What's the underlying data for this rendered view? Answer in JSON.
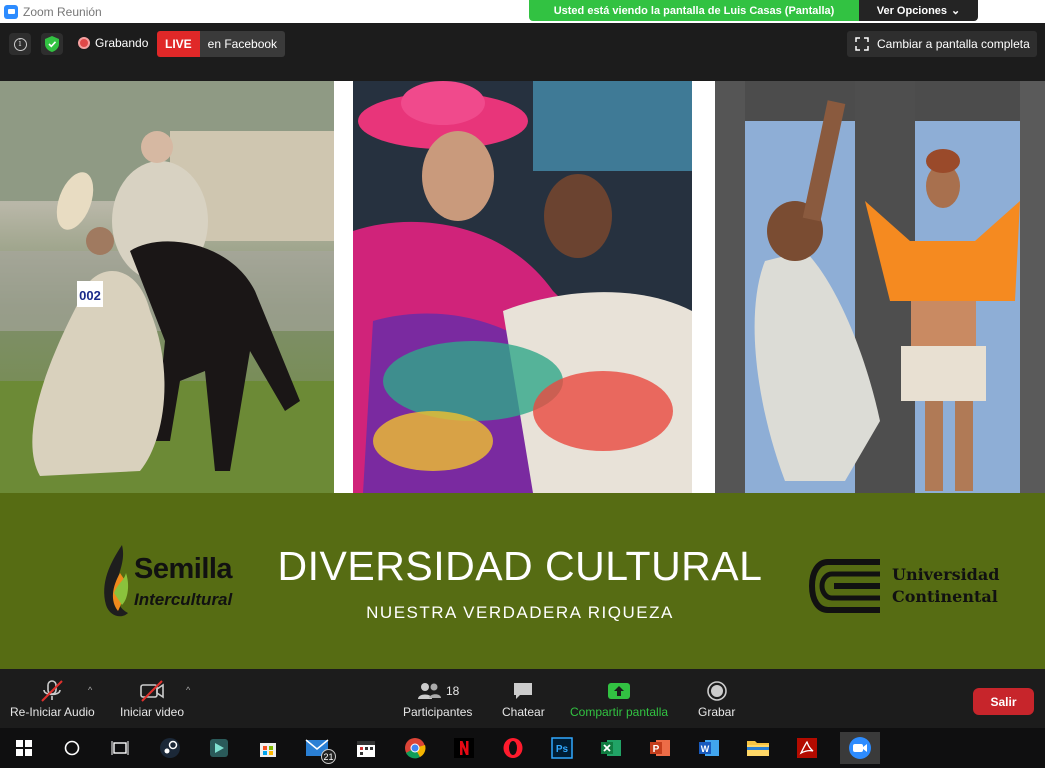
{
  "window": {
    "title": "Zoom Reunión"
  },
  "share_banner": {
    "message": "Usted está viendo la pantalla de Luis Casas (Pantalla)",
    "options_label": "Ver Opciones"
  },
  "top_bar": {
    "recording_label": "Grabando",
    "live_label": "LIVE",
    "live_platform": "en Facebook",
    "fullscreen_label": "Cambiar a pantalla completa"
  },
  "shared_slide": {
    "title": "DIVERSIDAD CULTURAL",
    "subtitle": "NUESTRA VERDADERA RIQUEZA",
    "logo_left": {
      "line1": "Semilla",
      "line2": "Intercultural"
    },
    "logo_right": {
      "line1": "Universidad",
      "line2": "Continental"
    },
    "bib_number": "002",
    "banner_color": "#566c13"
  },
  "controls": {
    "audio_label": "Re-Iniciar Audio",
    "video_label": "Iniciar video",
    "participants_label": "Participantes",
    "participants_count": "18",
    "chat_label": "Chatear",
    "share_label": "Compartir pantalla",
    "record_label": "Grabar",
    "leave_label": "Salir",
    "share_color": "#32c242",
    "leave_color": "#c7252b"
  },
  "taskbar": {
    "mail_badge": "21",
    "icons": [
      "windows-start-icon",
      "search-circle-icon",
      "task-view-icon",
      "steam-icon",
      "filmora-icon",
      "store-icon",
      "mail-icon",
      "calendar-icon",
      "chrome-icon",
      "netflix-icon",
      "opera-icon",
      "photoshop-icon",
      "excel-icon",
      "powerpoint-icon",
      "word-icon",
      "file-explorer-icon",
      "acrobat-icon",
      "zoom-icon"
    ]
  }
}
